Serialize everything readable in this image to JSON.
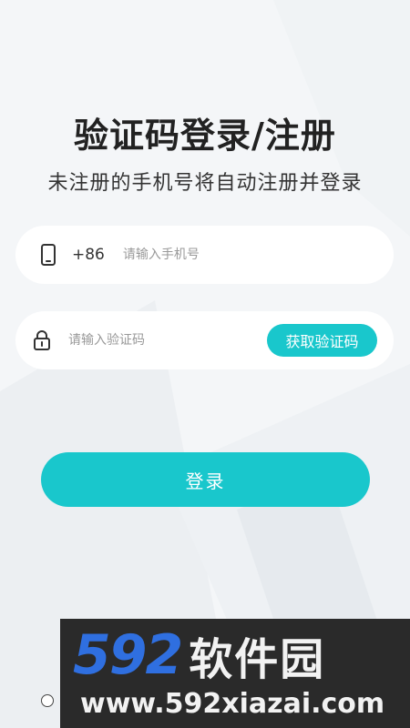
{
  "header": {
    "title": "验证码登录/注册",
    "subtitle": "未注册的手机号将自动注册并登录"
  },
  "phone_field": {
    "icon": "phone-icon",
    "prefix": "+86",
    "placeholder": "请输入手机号",
    "value": ""
  },
  "code_field": {
    "icon": "lock-icon",
    "placeholder": "请输入验证码",
    "value": "",
    "get_code_label": "获取验证码"
  },
  "login_button": {
    "label": "登录"
  },
  "agreement": {
    "checked": false
  },
  "watermark": {
    "brand_number": "592",
    "brand_text": "软件园",
    "url": "www.592xiazai.com"
  },
  "colors": {
    "accent": "#19c7cc",
    "background": "#f4f6f8",
    "title_text": "#222222",
    "placeholder_text": "#999999",
    "watermark_bg": "#2a2a2a",
    "watermark_blue": "#2f6fe0"
  }
}
